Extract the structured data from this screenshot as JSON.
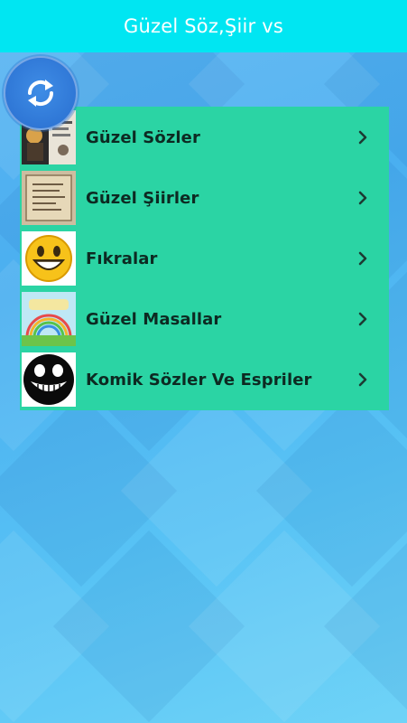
{
  "app": {
    "title": "Güzel Söz,Şiir vs"
  },
  "colors": {
    "app_bar": "#00e6f2",
    "menu_panel": "#2bd4a4",
    "background": "#4aaff0",
    "refresh_button": "#2f77d6"
  },
  "refresh_button": {
    "icon": "refresh-icon"
  },
  "menu": {
    "items": [
      {
        "label": "Güzel Sözler",
        "icon": "quote-photo-thumbnail",
        "arrow": "chevron-right-icon"
      },
      {
        "label": "Güzel Şiirler",
        "icon": "parchment-poem-thumbnail",
        "arrow": "chevron-right-icon"
      },
      {
        "label": "Fıkralar",
        "icon": "laughing-smiley-thumbnail",
        "arrow": "chevron-right-icon"
      },
      {
        "label": "Güzel Masallar",
        "icon": "fairytale-rainbow-thumbnail",
        "arrow": "chevron-right-icon"
      },
      {
        "label": "Komik Sözler Ve Espriler",
        "icon": "dark-grin-face-thumbnail",
        "arrow": "chevron-right-icon"
      }
    ]
  }
}
